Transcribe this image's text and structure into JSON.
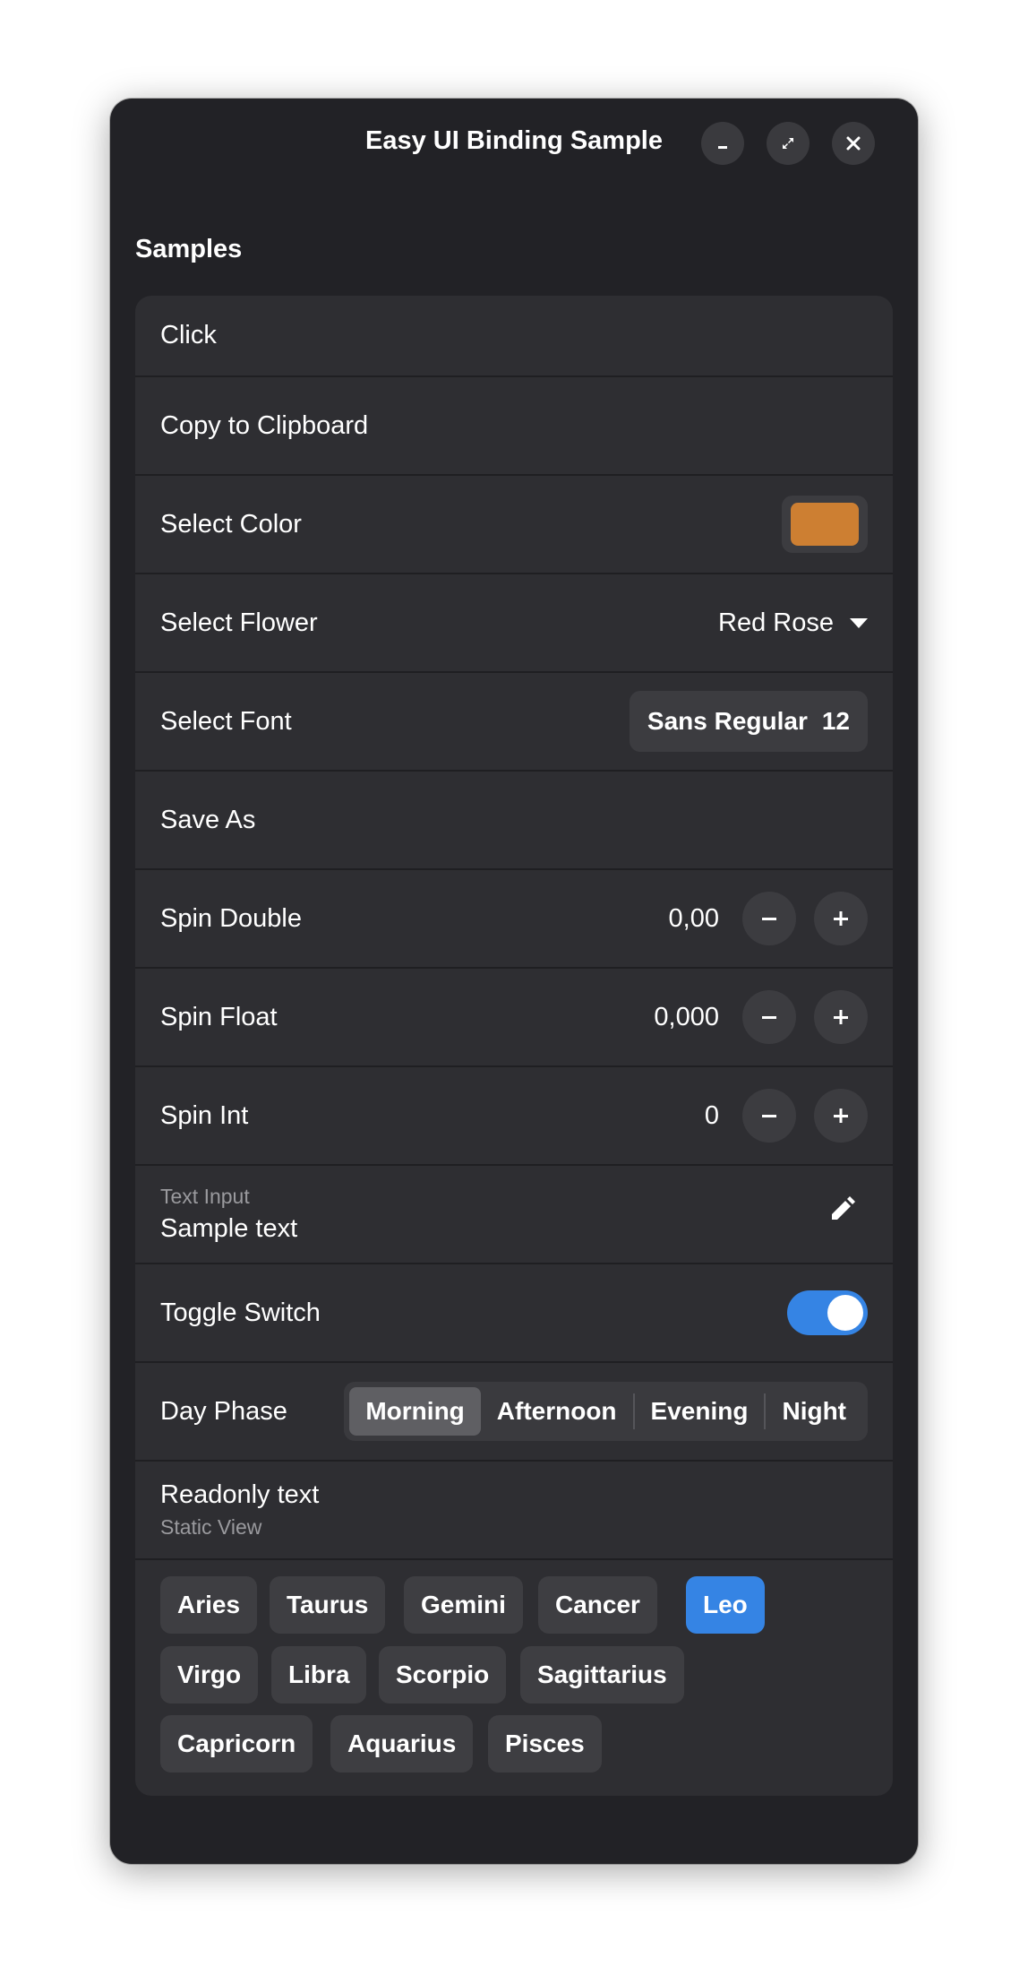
{
  "window": {
    "title": "Easy UI Binding Sample",
    "controls": [
      "minimize-icon",
      "maximize-icon",
      "close-icon"
    ]
  },
  "section": {
    "title": "Samples"
  },
  "rows": {
    "click": "Click",
    "copy": "Copy to Clipboard",
    "select_color": {
      "label": "Select Color",
      "value": "#cd7f32"
    },
    "select_flower": {
      "label": "Select Flower",
      "value": "Red Rose"
    },
    "select_font": {
      "label": "Select Font",
      "font_name": "Sans Regular",
      "font_size": "12"
    },
    "save_as": "Save As",
    "spin_double": {
      "label": "Spin Double",
      "value": "0,00"
    },
    "spin_float": {
      "label": "Spin Float",
      "value": "0,000"
    },
    "spin_int": {
      "label": "Spin Int",
      "value": "0"
    },
    "text_input": {
      "label": "Text Input",
      "value": "Sample text"
    },
    "toggle": {
      "label": "Toggle Switch",
      "on": true
    },
    "day_phase": {
      "label": "Day Phase",
      "options": [
        "Morning",
        "Afternoon",
        "Evening",
        "Night"
      ],
      "selected": "Morning"
    },
    "readonly": {
      "title": "Readonly text",
      "subtitle": "Static View"
    }
  },
  "zodiac": {
    "items": [
      "Aries",
      "Taurus",
      "Gemini",
      "Cancer",
      "Leo",
      "Virgo",
      "Libra",
      "Scorpio",
      "Sagittarius",
      "Capricorn",
      "Aquarius",
      "Pisces"
    ],
    "selected": "Leo"
  },
  "colors": {
    "window_bg": "#222226",
    "list_bg": "#2e2e32",
    "accent": "#3584e4"
  }
}
